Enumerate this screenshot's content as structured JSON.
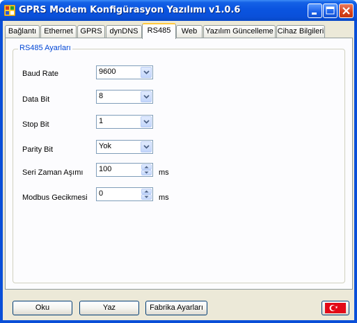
{
  "window": {
    "title": "GPRS Modem Konfigürasyon Yazılımı v1.0.6"
  },
  "tabs": [
    {
      "label": "Bağlantı"
    },
    {
      "label": "Ethernet"
    },
    {
      "label": "GPRS"
    },
    {
      "label": "dynDNS"
    },
    {
      "label": "RS485",
      "active": true
    },
    {
      "label": "Web"
    },
    {
      "label": "Yazılım Güncelleme"
    },
    {
      "label": "Cihaz Bilgileri"
    }
  ],
  "group": {
    "title": "RS485 Ayarları"
  },
  "fields": {
    "baud_rate": {
      "label": "Baud Rate",
      "value": "9600"
    },
    "data_bit": {
      "label": "Data Bit",
      "value": "8"
    },
    "stop_bit": {
      "label": "Stop Bit",
      "value": "1"
    },
    "parity_bit": {
      "label": "Parity Bit",
      "value": "Yok"
    },
    "serial_timeout": {
      "label": "Seri Zaman Aşımı",
      "value": "100",
      "unit": "ms"
    },
    "modbus_delay": {
      "label": "Modbus Gecikmesi",
      "value": "0",
      "unit": "ms"
    }
  },
  "buttons": {
    "read": "Oku",
    "write": "Yaz",
    "factory": "Fabrika Ayarları"
  },
  "language_flag": "turkish-flag-icon"
}
